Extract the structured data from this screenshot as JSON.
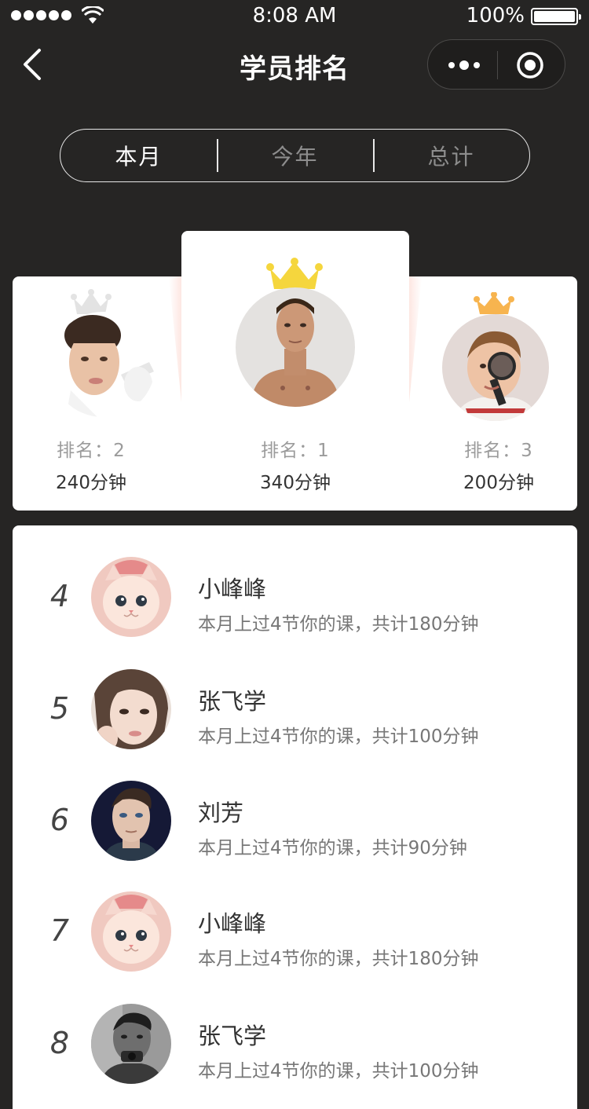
{
  "status_bar": {
    "time": "8:08 AM",
    "battery": "100%"
  },
  "nav": {
    "title": "学员排名"
  },
  "tabs": [
    {
      "label": "本月",
      "active": true
    },
    {
      "label": "今年",
      "active": false
    },
    {
      "label": "总计",
      "active": false
    }
  ],
  "podium": {
    "first": {
      "rank_label": "排名：1",
      "minutes": "340分钟",
      "crown_color": "#f5d63d"
    },
    "second": {
      "rank_label": "排名：2",
      "minutes": "240分钟",
      "crown_color": "#e3e3e3"
    },
    "third": {
      "rank_label": "排名：3",
      "minutes": "200分钟",
      "crown_color": "#f7b44f"
    }
  },
  "ranking": [
    {
      "rank": "4",
      "name": "小峰峰",
      "desc": "本月上过4节你的课，共计180分钟",
      "avatar": "cat-avatar"
    },
    {
      "rank": "5",
      "name": "张飞学",
      "desc": "本月上过4节你的课，共计100分钟",
      "avatar": "woman-avatar"
    },
    {
      "rank": "6",
      "name": "刘芳",
      "desc": "本月上过4节你的课，共计90分钟",
      "avatar": "man-dark-avatar"
    },
    {
      "rank": "7",
      "name": "小峰峰",
      "desc": "本月上过4节你的课，共计180分钟",
      "avatar": "cat-avatar"
    },
    {
      "rank": "8",
      "name": "张飞学",
      "desc": "本月上过4节你的课，共计100分钟",
      "avatar": "man-gray-avatar"
    }
  ]
}
